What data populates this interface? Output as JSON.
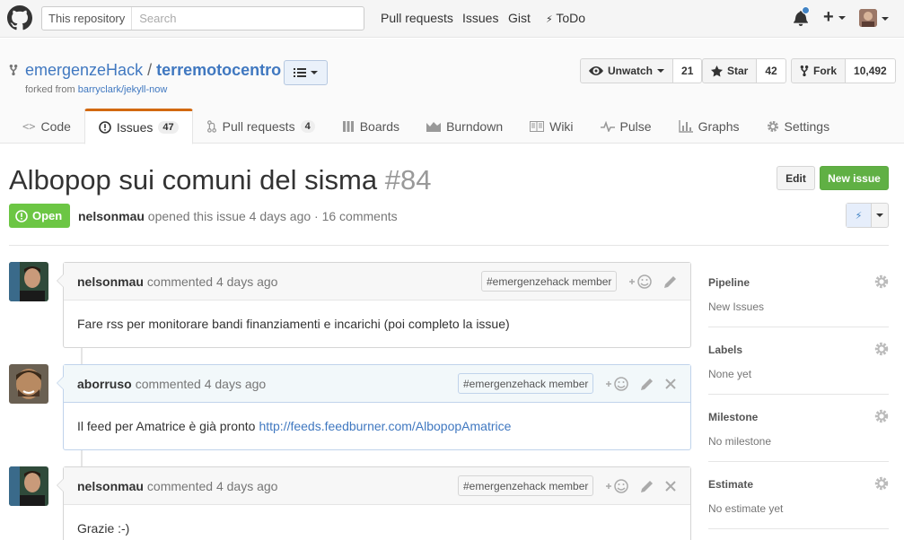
{
  "header": {
    "search_scope": "This repository",
    "search_placeholder": "Search",
    "nav": [
      "Pull requests",
      "Issues",
      "Gist",
      "ToDo"
    ]
  },
  "repo": {
    "owner": "emergenzeHack",
    "separator": "/",
    "name": "terremotocentro",
    "forked_prefix": "forked from",
    "forked_source": "barryclark/jekyll-now",
    "watch_label": "Unwatch",
    "watch_count": "21",
    "star_label": "Star",
    "star_count": "42",
    "fork_label": "Fork",
    "fork_count": "10,492"
  },
  "tabs": [
    {
      "label": "Code"
    },
    {
      "label": "Issues",
      "count": "47"
    },
    {
      "label": "Pull requests",
      "count": "4"
    },
    {
      "label": "Boards"
    },
    {
      "label": "Burndown"
    },
    {
      "label": "Wiki"
    },
    {
      "label": "Pulse"
    },
    {
      "label": "Graphs"
    },
    {
      "label": "Settings"
    }
  ],
  "issue": {
    "title": "Albopop sui comuni del sisma",
    "number": "#84",
    "edit_label": "Edit",
    "new_issue_label": "New issue",
    "state": "Open",
    "author": "nelsonmau",
    "meta_text": "opened this issue 4 days ago · 16 comments"
  },
  "comments": [
    {
      "author": "nelsonmau",
      "action": "commented 4 days ago",
      "badge": "#emergenzehack member",
      "body": "Fare rss per monitorare bandi finanziamenti e incarichi (poi completo la issue)",
      "link": ""
    },
    {
      "author": "aborruso",
      "action": "commented 4 days ago",
      "badge": "#emergenzehack member",
      "body": "Il feed per Amatrice è già pronto",
      "link": "http://feeds.feedburner.com/AlbopopAmatrice"
    },
    {
      "author": "nelsonmau",
      "action": "commented 4 days ago",
      "badge": "#emergenzehack member",
      "body": "Grazie :-)",
      "link": ""
    }
  ],
  "sidebar": [
    {
      "heading": "Pipeline",
      "value": "New Issues"
    },
    {
      "heading": "Labels",
      "value": "None yet"
    },
    {
      "heading": "Milestone",
      "value": "No milestone"
    },
    {
      "heading": "Estimate",
      "value": "No estimate yet"
    }
  ],
  "colors": {
    "link": "#4078c0",
    "open_state": "#6cc644",
    "new_issue": "#60b044",
    "selected_tab_accent": "#d26911"
  }
}
